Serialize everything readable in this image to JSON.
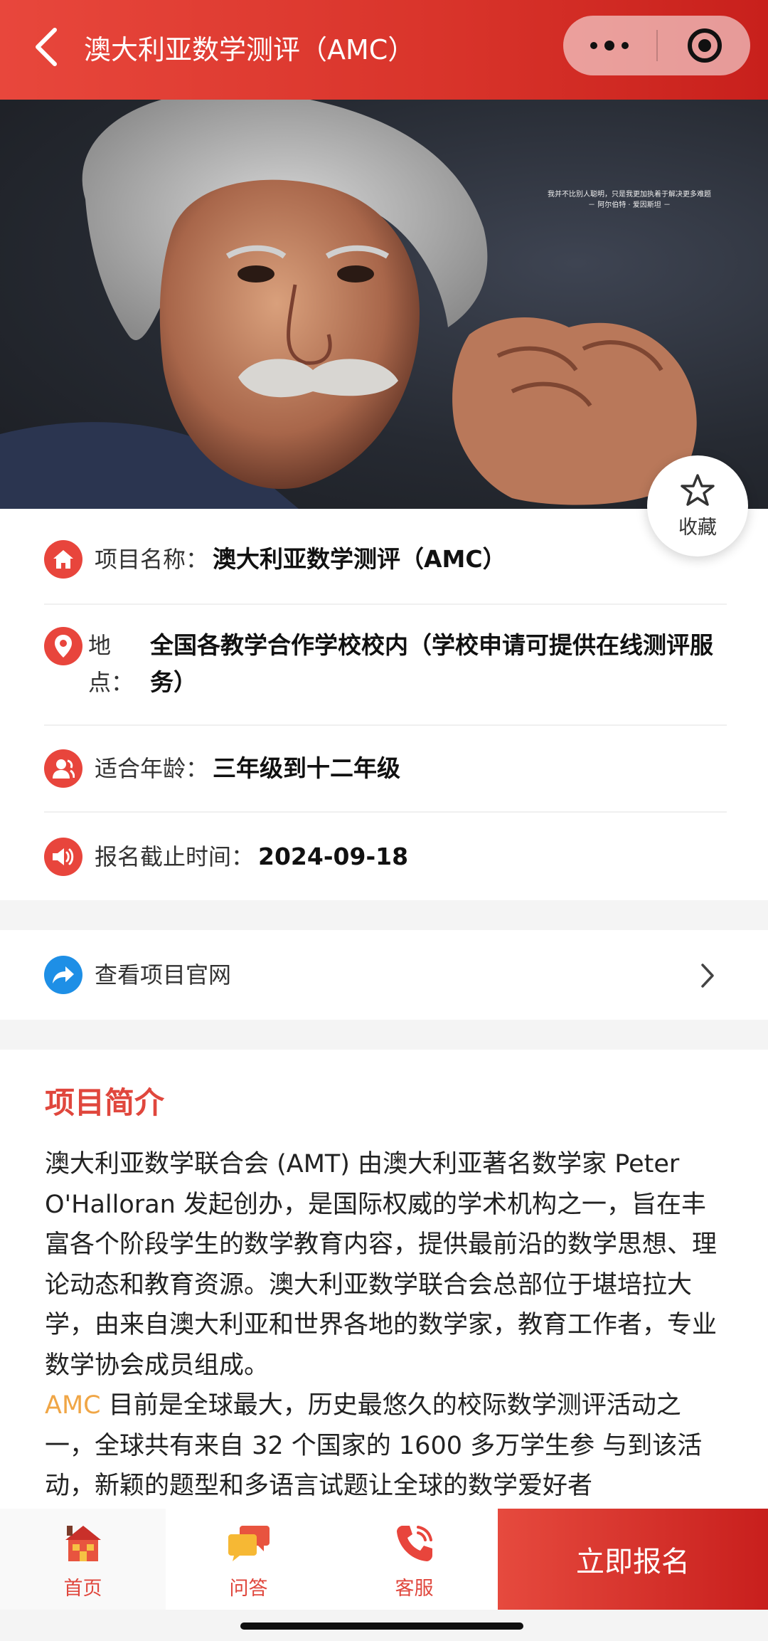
{
  "nav": {
    "title": "澳大利亚数学测评（AMC）",
    "icons": {
      "back": "back-arrow-icon",
      "more": "more-dots-icon",
      "close": "miniprogram-close-icon"
    }
  },
  "hero": {
    "quote_line1": "我并不比别人聪明，只是我更加执着于解决更多难题",
    "quote_line2": "－ 阿尔伯特 · 爱因斯坦 －"
  },
  "favorite": {
    "label": "收藏",
    "icon": "star-icon"
  },
  "info": {
    "name_label": "项目名称：",
    "name_value": "澳大利亚数学测评（AMC）",
    "location_label_1": "地",
    "location_label_2": "点：",
    "location_value": "全国各教学合作学校校内（学校申请可提供在线测评服务）",
    "age_label": "适合年龄：",
    "age_value": "三年级到十二年级",
    "deadline_label": "报名截止时间：",
    "deadline_value": "2024-09-18"
  },
  "website_link": {
    "label": "查看项目官网",
    "icon": "share-arrow-icon"
  },
  "intro": {
    "title": "项目简介",
    "para1": "澳大利亚数学联合会 (AMT) 由澳大利亚著名数学家 Peter O'Halloran 发起创办，是国际权威的学术机构之一，旨在丰富各个阶段学生的数学教育内容，提供最前沿的数学思想、理论动态和教育资源。澳大利亚数学联合会总部位于堪培拉大学，由来自澳大利亚和世界各地的数学家，教育工作者，专业数学协会成员组成。",
    "amc": "AMC",
    "para2": " 目前是全球最大，历史最悠久的校际数学测评活动之一，全球共有来自 32 个国家的 1600 多万学生参 与到该活动，新颖的题型和多语言试题让全球的数学爱好者"
  },
  "bottom": {
    "home": "首页",
    "qa": "问答",
    "service": "客服",
    "signup": "立即报名"
  },
  "colors": {
    "brand_red": "#e0473d",
    "link_blue": "#1e8fe6",
    "amc_orange": "#f0a646"
  }
}
